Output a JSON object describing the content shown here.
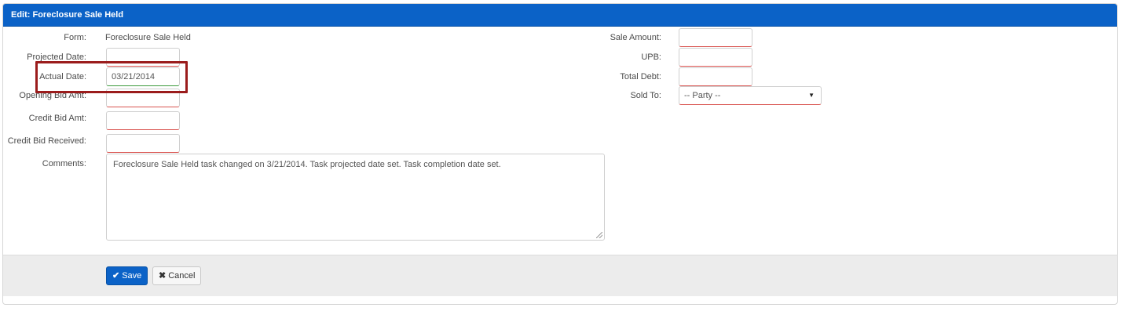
{
  "header": {
    "title": "Edit: Foreclosure Sale Held"
  },
  "left_fields": {
    "form_label": "Form:",
    "form_value": "Foreclosure Sale Held",
    "projected_date_label": "Projected Date:",
    "projected_date_value": "",
    "actual_date_label": "Actual Date:",
    "actual_date_value": "03/21/2014",
    "opening_bid_label": "Opening Bid Amt:",
    "opening_bid_value": "",
    "credit_bid_label": "Credit Bid Amt:",
    "credit_bid_value": "",
    "credit_bid_received_label": "Credit Bid Received:",
    "credit_bid_received_value": "",
    "comments_label": "Comments:",
    "comments_value": "Foreclosure Sale Held task changed on 3/21/2014.  Task projected date set.  Task completion date set."
  },
  "right_fields": {
    "sale_amount_label": "Sale Amount:",
    "sale_amount_value": "",
    "upb_label": "UPB:",
    "upb_value": "",
    "total_debt_label": "Total Debt:",
    "total_debt_value": "",
    "sold_to_label": "Sold To:",
    "sold_to_value": "-- Party --"
  },
  "footer": {
    "save_label": "Save",
    "cancel_label": "Cancel"
  },
  "icons": {
    "save": "checkmark-icon",
    "cancel": "x-icon",
    "dropdown": "caret-down-icon"
  },
  "colors": {
    "header_bg": "#0b62c7",
    "required_border": "#d9534f",
    "valid_border": "#3c9a3c",
    "highlight_box": "#9b1c1c"
  }
}
